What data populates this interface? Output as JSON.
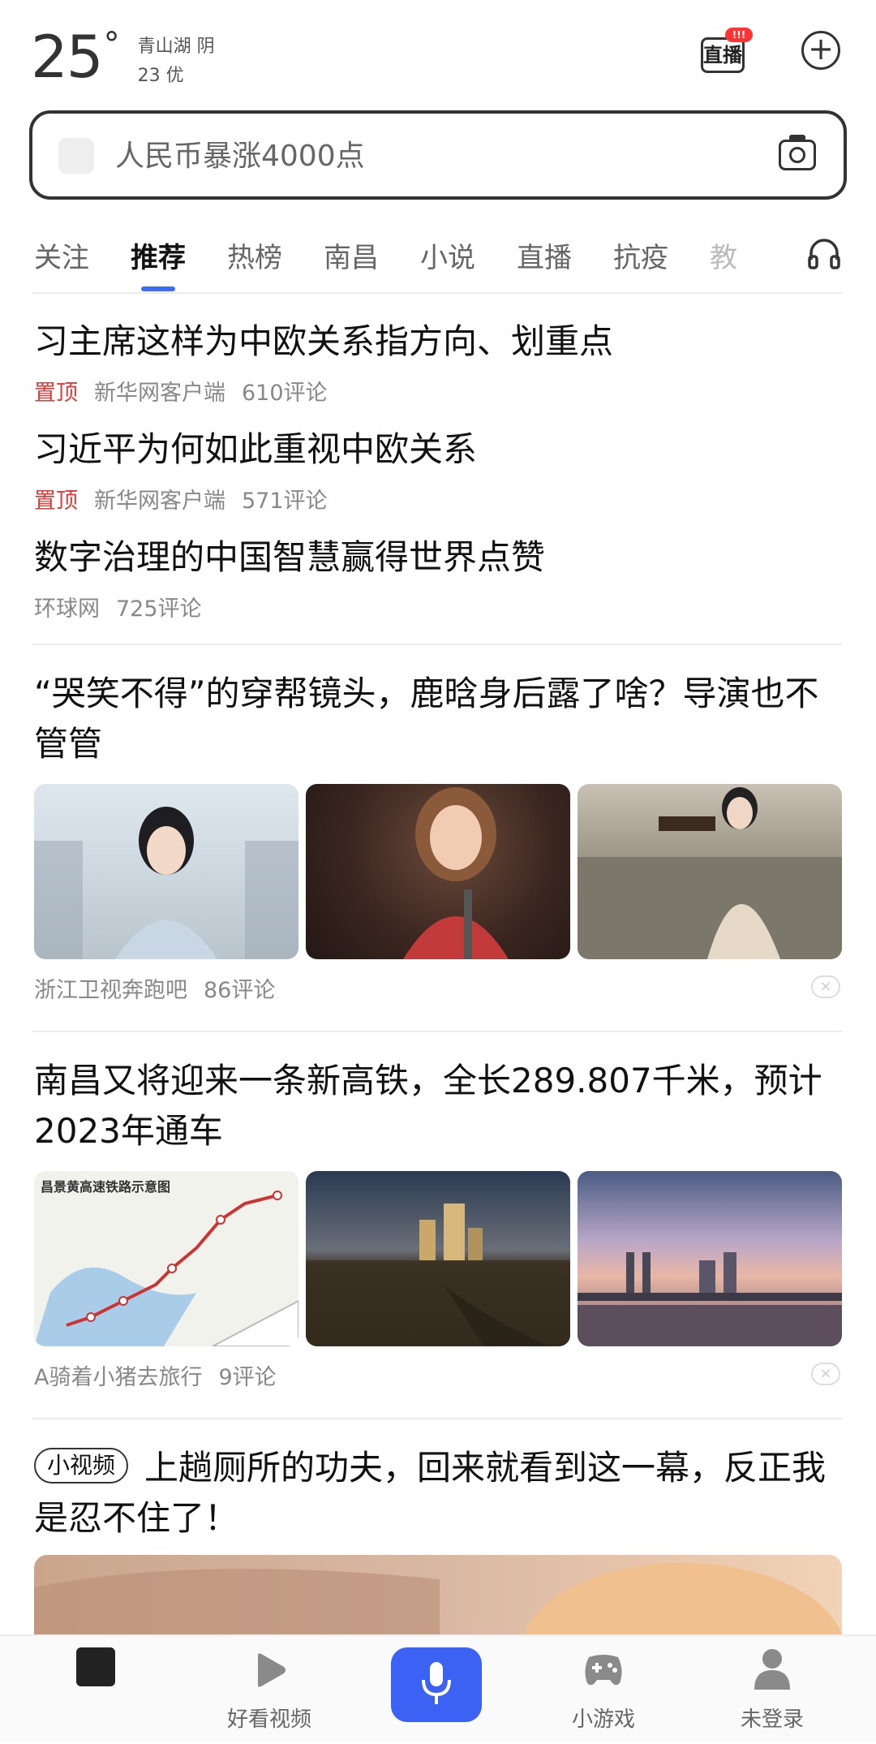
{
  "status": {
    "temperature": "25",
    "degree": "°",
    "location_weather": "青山湖 阴",
    "aqi": "23 优"
  },
  "header": {
    "live_label": "直播",
    "live_badge": "!!!"
  },
  "search": {
    "placeholder": "人民币暴涨4000点"
  },
  "tabs": [
    "关注",
    "推荐",
    "热榜",
    "南昌",
    "小说",
    "直播",
    "抗疫",
    "教"
  ],
  "active_tab": "推荐",
  "pinned_news": [
    {
      "title": "习主席这样为中欧关系指方向、划重点",
      "tag": "置顶",
      "source": "新华网客户端",
      "comments": "610评论"
    },
    {
      "title": "习近平为何如此重视中欧关系",
      "tag": "置顶",
      "source": "新华网客户端",
      "comments": "571评论"
    },
    {
      "title": "数字治理的中国智慧赢得世界点赞",
      "source": "环球网",
      "comments": "725评论"
    }
  ],
  "feed": [
    {
      "title": "“哭笑不得”的穿帮镜头，鹿晗身后露了啥？导演也不管管",
      "source": "浙江卫视奔跑吧",
      "comments": "86评论"
    },
    {
      "title": "南昌又将迎来一条新高铁，全长289.807千米，预计2023年通车",
      "source": "A骑着小猪去旅行",
      "comments": "9评论",
      "map_caption": "昌景黄高速铁路示意图"
    },
    {
      "tag": "小视频",
      "title": "上趟厕所的功夫，回来就看到这一幕，反正我是忍不住了！"
    }
  ],
  "bottom_nav": [
    {
      "label": ""
    },
    {
      "label": "好看视频"
    },
    {
      "label": ""
    },
    {
      "label": "小游戏"
    },
    {
      "label": "未登录"
    }
  ]
}
